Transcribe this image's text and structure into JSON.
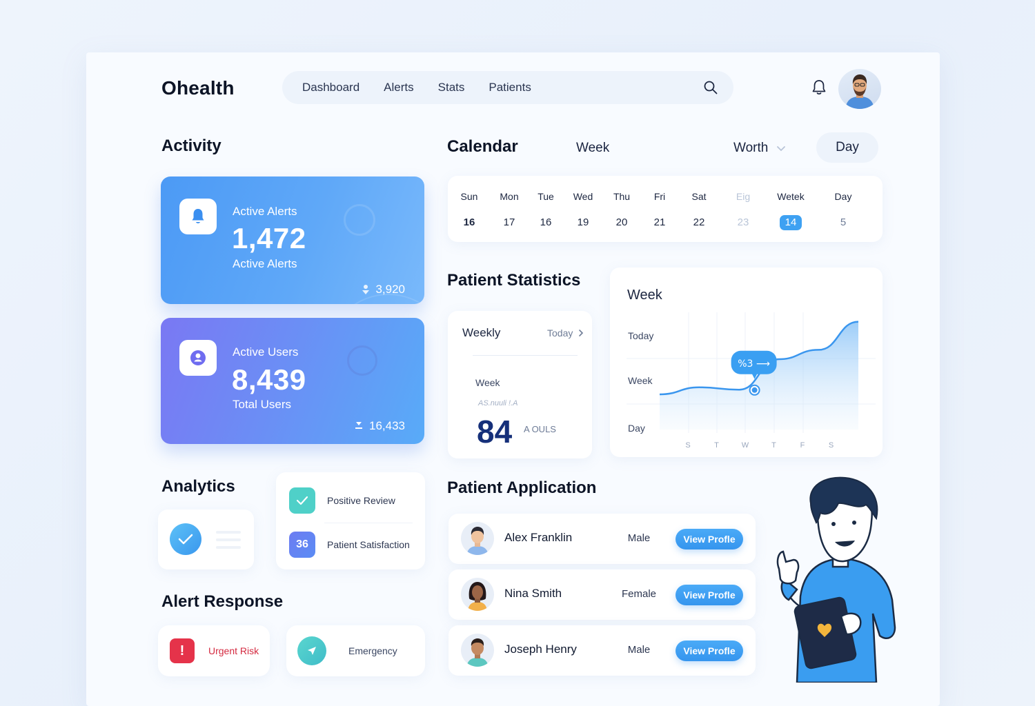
{
  "app": {
    "logo": "Ohealth"
  },
  "nav": {
    "items": [
      "Dashboard",
      "Alerts",
      "Stats",
      "Patients"
    ]
  },
  "activity": {
    "title": "Activity",
    "alerts_card": {
      "label_top": "Active Alerts",
      "value": "1,472",
      "label_bottom": "Active Alerts",
      "footer": "3,920",
      "icon": "bell-icon"
    },
    "users_card": {
      "label_top": "Active Users",
      "value": "8,439",
      "label_bottom": "Total Users",
      "footer": "16,433",
      "icon": "user-icon"
    }
  },
  "calendar": {
    "title": "Calendar",
    "tab_week": "Week",
    "tab_worth": "Worth",
    "tab_day": "Day",
    "days": [
      {
        "name": "Sun",
        "date": "16",
        "state": "bold"
      },
      {
        "name": "Mon",
        "date": "17",
        "state": ""
      },
      {
        "name": "Tue",
        "date": "16",
        "state": ""
      },
      {
        "name": "Wed",
        "date": "19",
        "state": ""
      },
      {
        "name": "Thu",
        "date": "20",
        "state": ""
      },
      {
        "name": "Fri",
        "date": "21",
        "state": ""
      },
      {
        "name": "Sat",
        "date": "22",
        "state": ""
      },
      {
        "name": "Eig",
        "date": "23",
        "state": "muted"
      },
      {
        "name": "Wetek",
        "date": "14",
        "state": "sel"
      },
      {
        "name": "Day",
        "date": "5",
        "state": "soft"
      }
    ]
  },
  "patient_statistics": {
    "title": "Patient Statistics",
    "weekly": {
      "title": "Weekly",
      "link": "Today",
      "sub": "Week",
      "note": "AS.nuuli !.A",
      "value": "84",
      "unit": "A OULS"
    }
  },
  "chart_data": {
    "type": "area",
    "title": "Week",
    "x": [
      "S",
      "T",
      "W",
      "T",
      "F",
      "S"
    ],
    "y_labels": [
      "Today",
      "Week",
      "Day"
    ],
    "series": [
      {
        "values": [
          0.3,
          0.36,
          0.34,
          0.6,
          0.68,
          0.92
        ]
      }
    ],
    "marker": {
      "label": "%3 ⟶",
      "index": 1
    },
    "ylim": [
      0,
      1
    ],
    "grid": true,
    "color": "#3a96ee"
  },
  "analytics": {
    "title": "Analytics",
    "items": [
      {
        "label": "Positive Review",
        "badge": "",
        "icon": "check-icon"
      },
      {
        "label": "Patient Satisfaction",
        "badge": "36",
        "icon": ""
      }
    ]
  },
  "alert_response": {
    "title": "Alert Response",
    "urgent": {
      "label": "Urgent Risk",
      "icon": "exclamation-icon"
    },
    "emergency": {
      "label": "Emergency",
      "icon": "send-icon"
    }
  },
  "patient_application": {
    "title": "Patient Application",
    "button_label": "View Profle",
    "patients": [
      {
        "name": "Alex Franklin",
        "gender": "Male"
      },
      {
        "name": "Nina Smith",
        "gender": "Female"
      },
      {
        "name": "Joseph Henry",
        "gender": "Male"
      }
    ]
  },
  "colors": {
    "accent": "#3ea1f2",
    "urgent": "#e5334a",
    "teal": "#4cc9c7",
    "indigo": "#6d7cf2"
  }
}
